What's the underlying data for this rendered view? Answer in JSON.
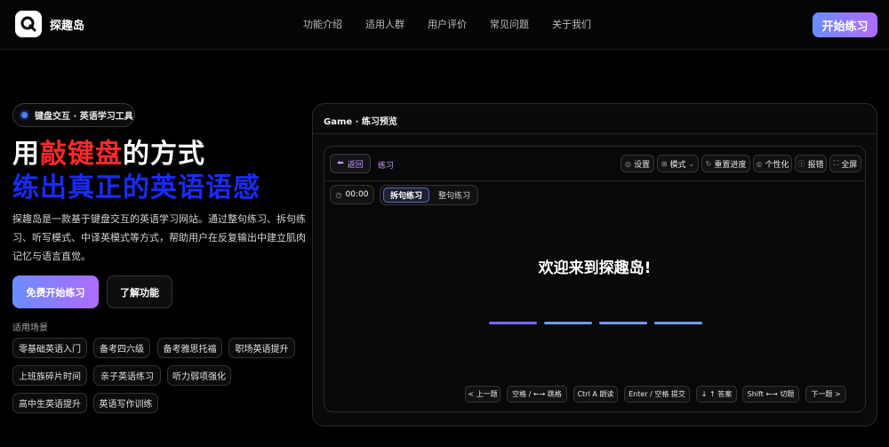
{
  "header": {
    "brand": "探趣岛",
    "nav": [
      "功能介绍",
      "适用人群",
      "用户评价",
      "常见问题",
      "关于我们"
    ],
    "cta": "开始练习"
  },
  "hero": {
    "badge": "键盘交互 · 英语学习工具",
    "title_prefix": "用",
    "title_accent": "敲键盘",
    "title_suffix": "的方式",
    "title_line2": "练出真正的英语语感",
    "description": "探趣岛是一款基于键盘交互的英语学习网站。通过整句练习、拆句练习、听写模式、中译英模式等方式，帮助用户在反复输出中建立肌肉记忆与语言直觉。",
    "primary_button": "免费开始练习",
    "secondary_button": "了解功能",
    "scenarios_label": "适用场景",
    "scenarios": [
      "零基础英语入门",
      "备考四六级",
      "备考雅思托福",
      "职场英语提升",
      "上班族碎片时间",
      "亲子英语练习",
      "听力弱项强化",
      "高中生英语提升",
      "英语写作训练"
    ]
  },
  "preview": {
    "title": "Game · 练习预览",
    "back": "返回",
    "mode": "练习",
    "tools": [
      "设置",
      "模式",
      "重置进度",
      "个性化",
      "报错",
      "全屏"
    ],
    "timer": "00:00",
    "tabs": [
      "拆句练习",
      "整句练习"
    ],
    "welcome": "欢迎来到探趣岛!",
    "hotkeys": [
      "< 上一题",
      "空格 / ←→  跳格",
      "Ctrl A  朗读",
      "Enter / 空格  提交",
      "↓ ↑  答案",
      "Shift ←→  切题",
      "下一题 >"
    ],
    "blank_colors": [
      "#7a6bff",
      "#6b9dff",
      "#6b9dff",
      "#6b9dff"
    ]
  },
  "colors": {
    "accent_gradient_start": "#6b8cff",
    "accent_gradient_end": "#b06bff",
    "title_red": "#ff2a2a",
    "title_blue": "#1a2bff"
  }
}
